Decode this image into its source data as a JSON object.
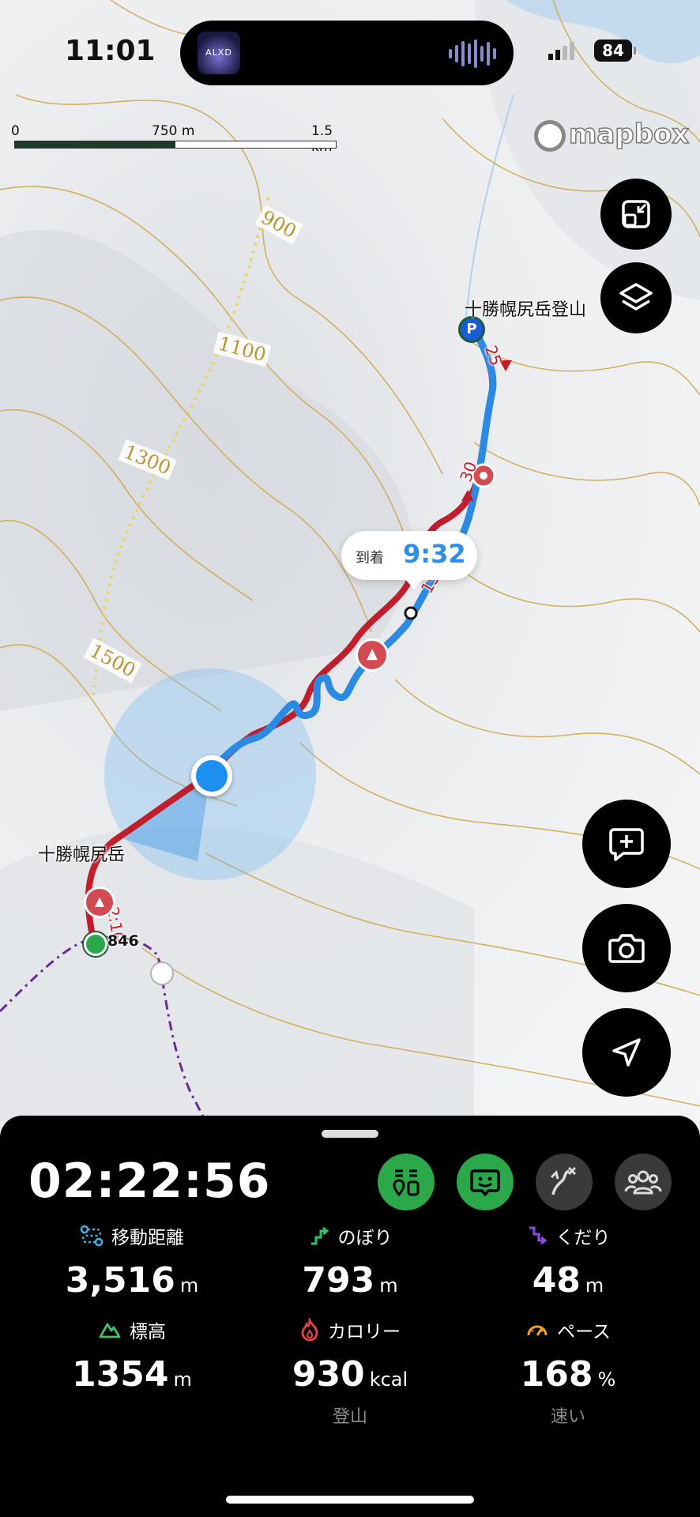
{
  "status_bar": {
    "time": "11:01",
    "album_art_text": "ALXD",
    "battery": "84"
  },
  "map": {
    "scale": {
      "start": "0",
      "mid": "750 m",
      "end": "1.5 km"
    },
    "attribution": "mapbox",
    "contours": [
      "900",
      "1100",
      "1300",
      "1500"
    ],
    "places": {
      "trailhead": "十勝幌尻岳登山",
      "summit": "十勝幌尻岳",
      "peak_elev": "846"
    },
    "course_times": [
      "25",
      "30",
      "15",
      "2:10"
    ],
    "arrival": {
      "label": "到着",
      "time": "9:32"
    },
    "colors": {
      "track": "#2b8ae3",
      "planned_route": "#c21d2a",
      "location": "#1d8ff0",
      "contour": "#cfa64a"
    }
  },
  "panel": {
    "elapsed": "02:22:56",
    "stats": [
      {
        "icon": "route-distance-icon",
        "label": "移動距離",
        "value": "3,516",
        "unit": "m"
      },
      {
        "icon": "ascent-icon",
        "label": "のぼり",
        "value": "793",
        "unit": "m"
      },
      {
        "icon": "descent-icon",
        "label": "くだり",
        "value": "48",
        "unit": "m"
      },
      {
        "icon": "elevation-icon",
        "label": "標高",
        "value": "1354",
        "unit": "m"
      },
      {
        "icon": "calorie-icon",
        "label": "カロリー",
        "value": "930",
        "unit": "kcal",
        "sub": "登山"
      },
      {
        "icon": "pace-icon",
        "label": "ペース",
        "value": "168",
        "unit": "%",
        "sub": "速い"
      }
    ],
    "colors": {
      "active_button": "#2aa84a",
      "inactive_button": "#3a3a3a"
    }
  }
}
